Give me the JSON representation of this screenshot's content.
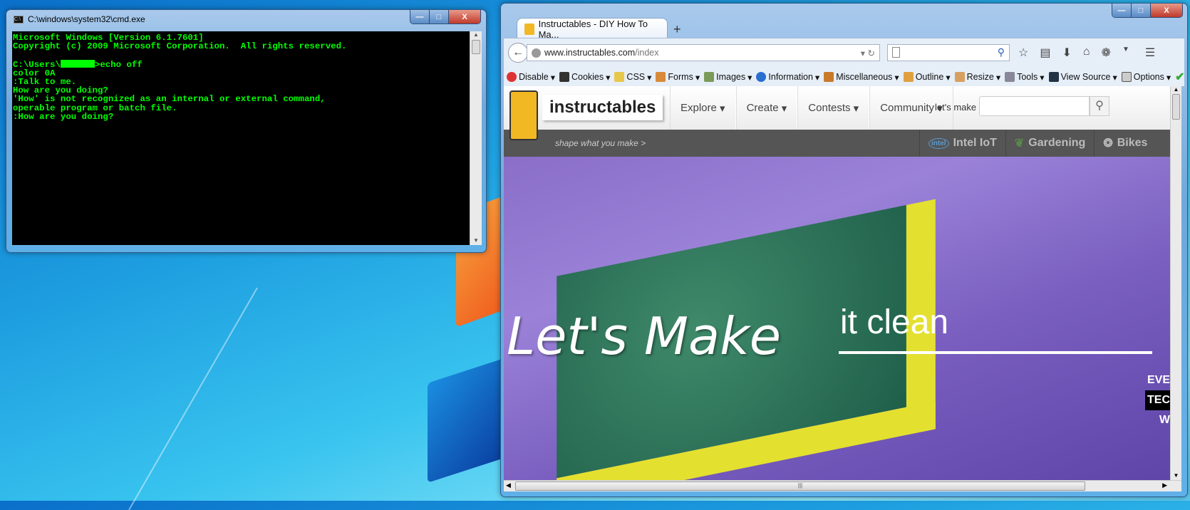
{
  "cmd": {
    "title": "C:\\windows\\system32\\cmd.exe",
    "icon": "cmd-icon",
    "lines": [
      "Microsoft Windows [Version 6.1.7601]",
      "Copyright (c) 2009 Microsoft Corporation.  All rights reserved.",
      "",
      "C:\\Users\\",
      "color 0A",
      ":Talk to me.",
      "How are you doing?",
      "'How' is not recognized as an internal or external command,",
      "operable program or batch file.",
      ":How are you doing?"
    ],
    "prompt_suffix": ">echo off",
    "colors": {
      "bg": "#000000",
      "fg": "#00ff00"
    }
  },
  "browser": {
    "tab_title": "Instructables - DIY How To Ma...",
    "new_tab": "+",
    "url_domain": "www.instructables.com",
    "url_path": "/index",
    "toolbar": [
      "Disable",
      "Cookies",
      "CSS",
      "Forms",
      "Images",
      "Information",
      "Miscellaneous",
      "Outline",
      "Resize",
      "Tools",
      "View Source",
      "Options"
    ],
    "site": {
      "logo": "instructables",
      "tagline": "shape what you make >",
      "nav": [
        "Explore",
        "Create",
        "Contests",
        "Community"
      ],
      "search_label": "let's make",
      "search_placeholder": "",
      "categories": [
        "Intel IoT",
        "Gardening",
        "Bikes"
      ],
      "hero_title": "Let's Make",
      "hero_sub": "it clean",
      "hero_side": [
        "EVE",
        "TEC",
        "W"
      ]
    }
  }
}
